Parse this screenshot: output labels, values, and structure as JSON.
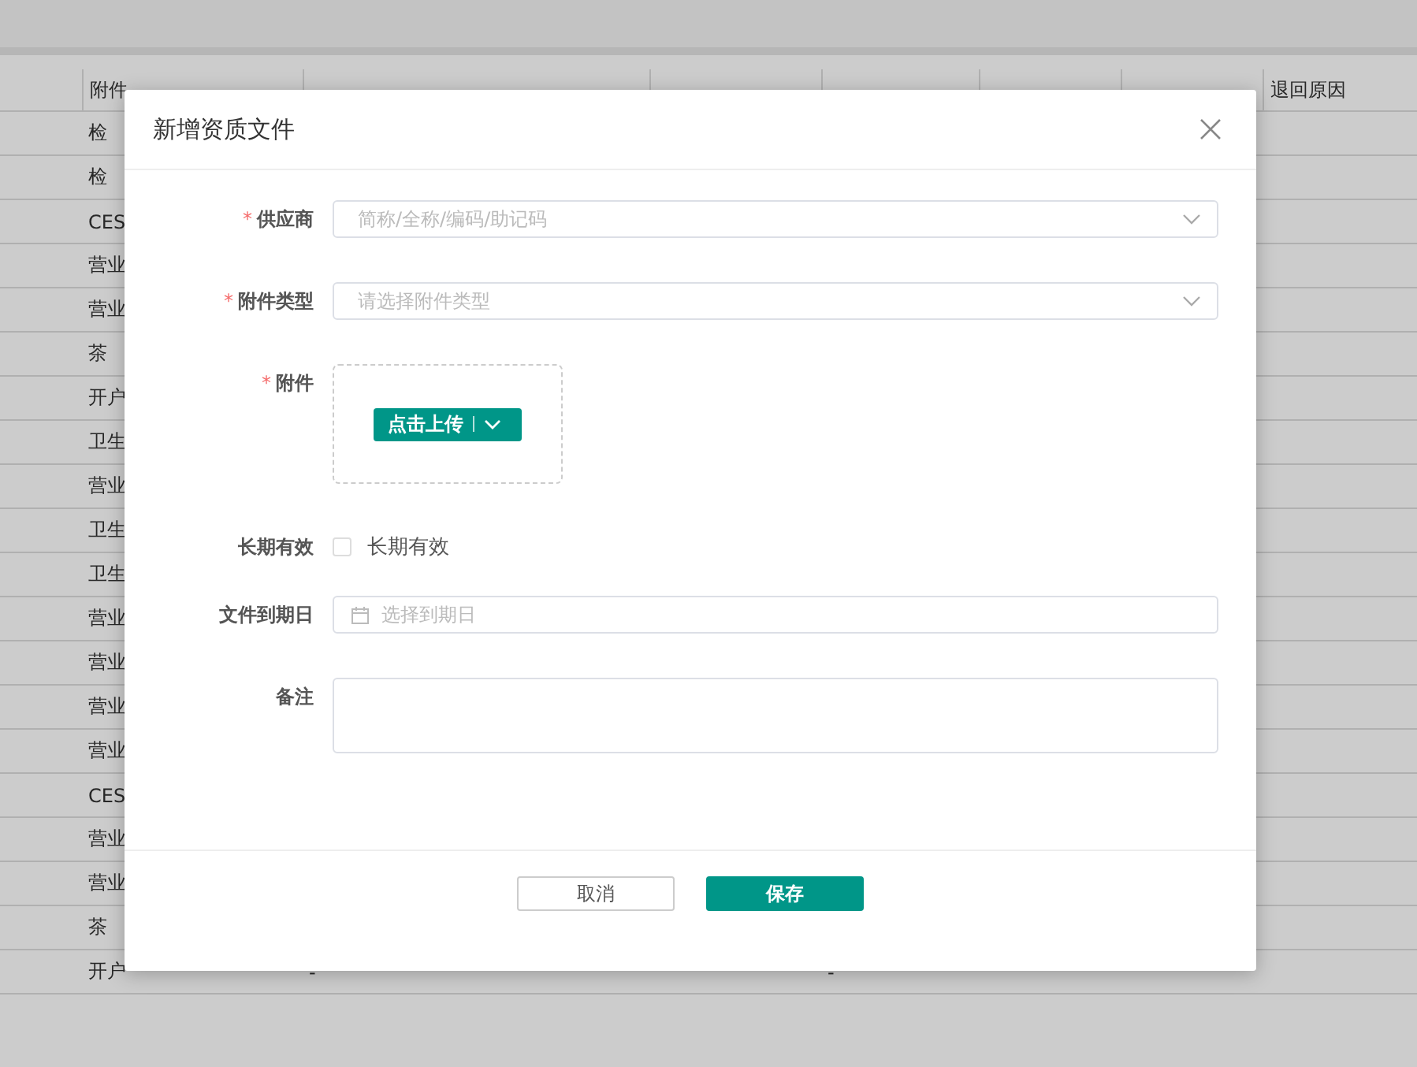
{
  "background_table": {
    "columns": [
      {
        "label": "附件"
      },
      {},
      {},
      {},
      {},
      {},
      {
        "label": "退回原因"
      }
    ],
    "rows": [
      {
        "cells": [
          "检"
        ]
      },
      {
        "cells": [
          "检"
        ]
      },
      {
        "cells": [
          "CES"
        ]
      },
      {
        "cells": [
          "营业"
        ]
      },
      {
        "cells": [
          "营业"
        ]
      },
      {
        "cells": [
          "茶"
        ]
      },
      {
        "cells": [
          "开户"
        ]
      },
      {
        "cells": [
          "卫生"
        ]
      },
      {
        "cells": [
          "营业"
        ]
      },
      {
        "cells": [
          "卫生"
        ]
      },
      {
        "cells": [
          "卫生"
        ]
      },
      {
        "cells": [
          "营业"
        ]
      },
      {
        "cells": [
          "营业"
        ]
      },
      {
        "cells": [
          "营业"
        ]
      },
      {
        "cells": [
          "营业"
        ]
      },
      {
        "cells": [
          "CES"
        ]
      },
      {
        "cells": [
          "营业"
        ]
      },
      {
        "cells": [
          "营业"
        ]
      },
      {
        "cells": [
          "茶"
        ]
      },
      {
        "cells": [
          "开户",
          "-",
          null,
          "-",
          null,
          null
        ]
      }
    ]
  },
  "dialog": {
    "title": "新增资质文件",
    "fields": [
      {
        "kind": "select",
        "label": "供应商",
        "mark": "*",
        "placeholder": "简称/全称/编码/助记码"
      },
      {
        "kind": "select",
        "label": "附件类型",
        "mark": "*",
        "placeholder": "请选择附件类型"
      },
      {
        "kind": "upload",
        "label": "附件",
        "mark": "*",
        "button": "点击上传"
      },
      {
        "kind": "checkbox",
        "label": "长期有效",
        "option": "长期有效",
        "checked": false
      },
      {
        "kind": "date",
        "label": "文件到期日",
        "placeholder": "选择到期日"
      },
      {
        "kind": "textarea",
        "label": "备注"
      }
    ],
    "buttons": [
      {
        "label": "取消",
        "primary": false
      },
      {
        "label": "保存",
        "primary": true
      }
    ]
  }
}
